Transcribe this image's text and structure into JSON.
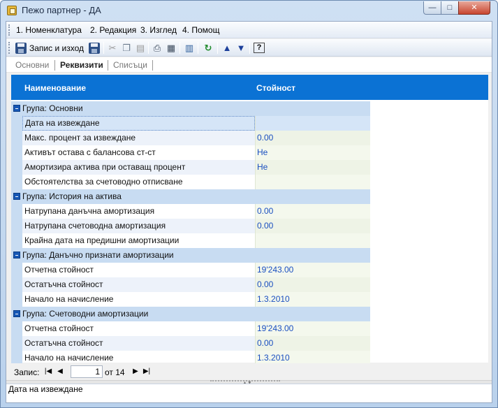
{
  "window": {
    "title": "Пежо партнер - ДА",
    "min_glyph": "—",
    "max_glyph": "□",
    "close_glyph": "✕"
  },
  "menu": {
    "items": [
      {
        "label": "1. Номенклатура"
      },
      {
        "label": "2. Редакция"
      },
      {
        "label": "3. Изглед"
      },
      {
        "label": "4. Помощ"
      }
    ]
  },
  "toolbar": {
    "save_label": "Запис и изход"
  },
  "tabs": [
    {
      "label": "Основни",
      "active": false
    },
    {
      "label": "Реквизити",
      "active": true
    },
    {
      "label": "Списъци",
      "active": false
    }
  ],
  "grid": {
    "header": {
      "name": "Наименование",
      "value": "Стойност"
    },
    "rows": [
      {
        "type": "group",
        "name": "Група: Основни"
      },
      {
        "type": "item",
        "name": "Дата на извеждане",
        "value": "",
        "selected": true
      },
      {
        "type": "item",
        "name": "Макс. процент за извеждане",
        "value": "0.00"
      },
      {
        "type": "item",
        "name": "Активът остава с балансова ст-ст",
        "value": "Не"
      },
      {
        "type": "item",
        "name": "Амортизира актива при оставащ процент",
        "value": "Не"
      },
      {
        "type": "item",
        "name": "Обстоятелства за счетоводно отписване",
        "value": ""
      },
      {
        "type": "group",
        "name": "Група: История на актива"
      },
      {
        "type": "item",
        "name": "Натрупана данъчна амортизация",
        "value": "0.00"
      },
      {
        "type": "item",
        "name": "Натрупана счетоводна амортизация",
        "value": "0.00"
      },
      {
        "type": "item",
        "name": "Крайна дата на предишни амортизации",
        "value": ""
      },
      {
        "type": "group",
        "name": "Група: Данъчно признати амортизации"
      },
      {
        "type": "item",
        "name": "Отчетна стойност",
        "value": "19'243.00"
      },
      {
        "type": "item",
        "name": "Остатъчна стойност",
        "value": "0.00"
      },
      {
        "type": "item",
        "name": "Начало на начисление",
        "value": "1.3.2010"
      },
      {
        "type": "group",
        "name": "Група: Счетоводни амортизации"
      },
      {
        "type": "item",
        "name": "Отчетна стойност",
        "value": "19'243.00"
      },
      {
        "type": "item",
        "name": "Остатъчна стойност",
        "value": "0.00"
      },
      {
        "type": "item",
        "name": "Начало на начисление",
        "value": "1.3.2010"
      }
    ]
  },
  "navigator": {
    "label": "Запис:",
    "current": "1",
    "of_text": "от 14"
  },
  "description": {
    "text": "Дата на извеждане"
  },
  "colors": {
    "header_bg": "#0b72d4",
    "group_bg": "#c8dcf2",
    "value_text": "#1a4fc0"
  }
}
